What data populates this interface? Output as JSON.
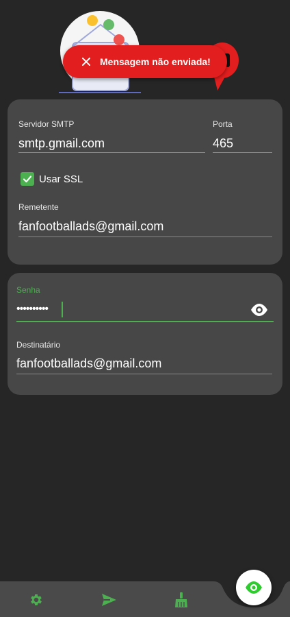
{
  "toast": {
    "message": "Mensagem não enviada!",
    "color": "#e21e1e"
  },
  "smtp": {
    "server_label": "Servidor SMTP",
    "server_value": "smtp.gmail.com",
    "port_label": "Porta",
    "port_value": "465",
    "ssl_label": "Usar SSL",
    "ssl_checked": true,
    "sender_label": "Remetente",
    "sender_value": "fanfootballads@gmail.com"
  },
  "auth": {
    "password_label": "Senha",
    "password_value": "••••••••••",
    "recipient_label": "Destinatário",
    "recipient_value": "fanfootballads@gmail.com"
  },
  "icons": {
    "toast_close": "close-icon",
    "show_password": "eye-icon",
    "settings": "gear-icon",
    "send": "send-icon",
    "clean": "broom-icon",
    "fab": "eye-icon"
  },
  "colors": {
    "accent": "#4caf50",
    "background": "#262626",
    "card": "#474747",
    "nav": "#4a4a4a"
  }
}
